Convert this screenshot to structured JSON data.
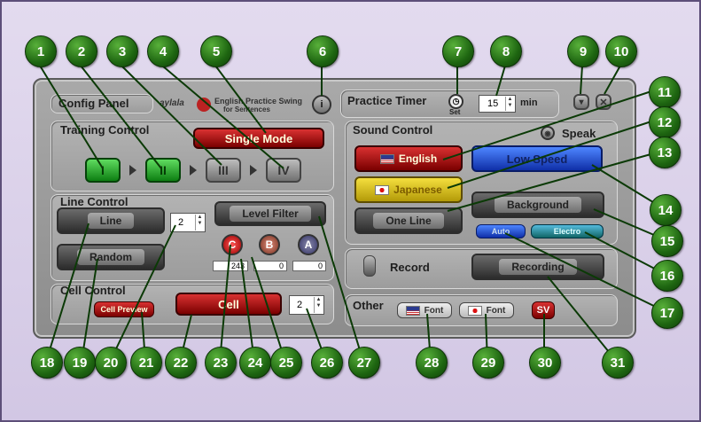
{
  "header": {
    "config_panel": "Config Panel",
    "logo_text": "aylala",
    "tagline_line1": "English Practice Swing",
    "tagline_line2": "for Sentences"
  },
  "timer": {
    "label": "Practice Timer",
    "set_label": "Set",
    "value": "15",
    "unit": "min"
  },
  "training": {
    "label": "Training Control",
    "single_mode": "Single Mode",
    "steps": [
      "I",
      "II",
      "III",
      "IV"
    ]
  },
  "line": {
    "label": "Line Control",
    "line_btn": "Line",
    "line_count": "2",
    "level_filter": "Level Filter",
    "random": "Random",
    "levels": [
      "C",
      "B",
      "A"
    ],
    "level_values": [
      "243",
      "0",
      "0"
    ]
  },
  "cell": {
    "label": "Cell Control",
    "preview": "Cell Preview",
    "cell_btn": "Cell",
    "cell_count": "2"
  },
  "sound": {
    "label": "Sound Control",
    "speak": "Speak",
    "english": "English",
    "low_speed": "Low Speed",
    "japanese": "Japanese",
    "background": "Background",
    "one_line": "One Line",
    "auto": "Auto",
    "electro": "Electro"
  },
  "record": {
    "label": "Record",
    "recording": "Recording"
  },
  "other": {
    "label": "Other",
    "font_en": "Font",
    "font_jp": "Font",
    "sv": "SV"
  },
  "callouts": [
    "1",
    "2",
    "3",
    "4",
    "5",
    "6",
    "7",
    "8",
    "9",
    "10",
    "11",
    "12",
    "13",
    "14",
    "15",
    "16",
    "17",
    "18",
    "19",
    "20",
    "21",
    "22",
    "23",
    "24",
    "25",
    "26",
    "27",
    "28",
    "29",
    "30",
    "31"
  ],
  "colors": {
    "accent_green": "#1e6611",
    "red": "#c41e1e",
    "blue": "#2b5ee6",
    "yellow": "#e0c21c"
  }
}
